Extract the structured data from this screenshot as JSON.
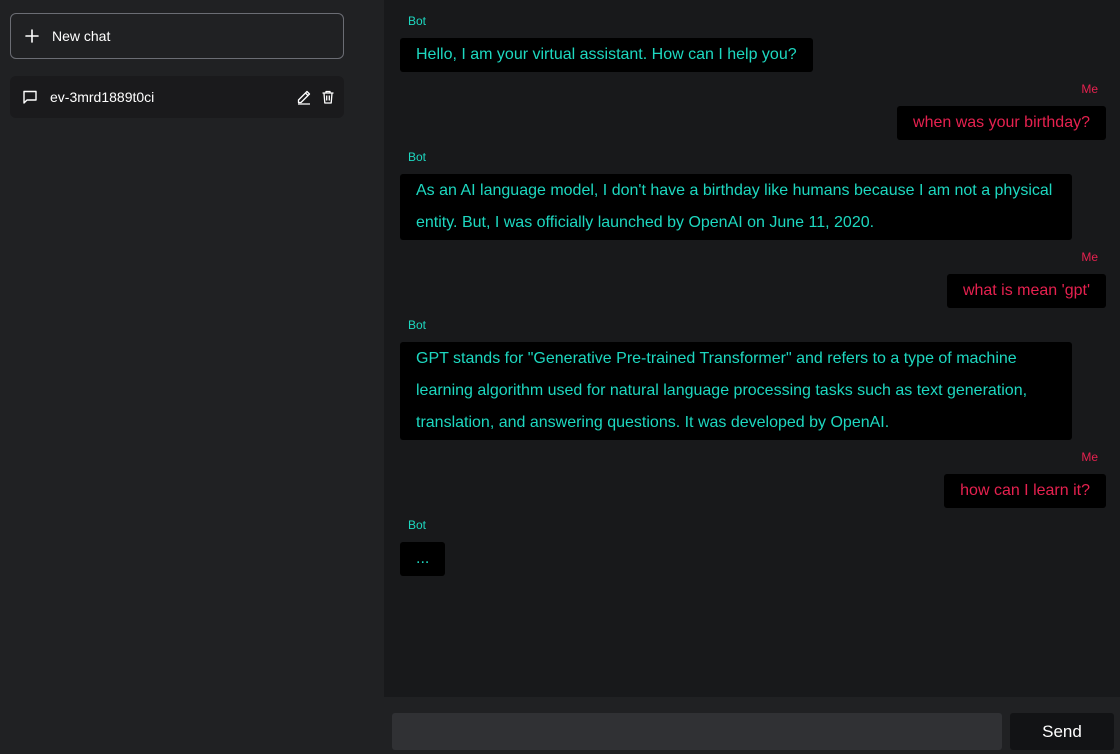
{
  "sidebar": {
    "new_chat_label": "New chat",
    "chats": [
      {
        "title": "ev-3mrd1889t0ci"
      }
    ]
  },
  "conversation": {
    "messages": [
      {
        "role": "bot",
        "sender": "Bot",
        "text": "Hello, I am your virtual assistant. How can I help you?"
      },
      {
        "role": "me",
        "sender": "Me",
        "text": "when was your birthday?"
      },
      {
        "role": "bot",
        "sender": "Bot",
        "lines": [
          "As an AI language model, I don't have a birthday like humans because I am not a physical",
          "entity. But, I was officially launched by OpenAI on June 11, 2020."
        ]
      },
      {
        "role": "me",
        "sender": "Me",
        "text": "what is mean 'gpt'"
      },
      {
        "role": "bot",
        "sender": "Bot",
        "lines": [
          "GPT stands for \"Generative Pre-trained Transformer\" and refers to a type of machine",
          "learning algorithm used for natural language processing tasks such as text generation,",
          "translation, and answering questions. It was developed by OpenAI."
        ]
      },
      {
        "role": "me",
        "sender": "Me",
        "text": "how can I learn it?"
      },
      {
        "role": "bot",
        "sender": "Bot",
        "text": "..."
      }
    ]
  },
  "composer": {
    "input_value": "",
    "send_label": "Send"
  },
  "colors": {
    "bot_text": "#1dd8c0",
    "user_text": "#e6214f",
    "background": "#18191b",
    "sidebar": "#202123"
  }
}
